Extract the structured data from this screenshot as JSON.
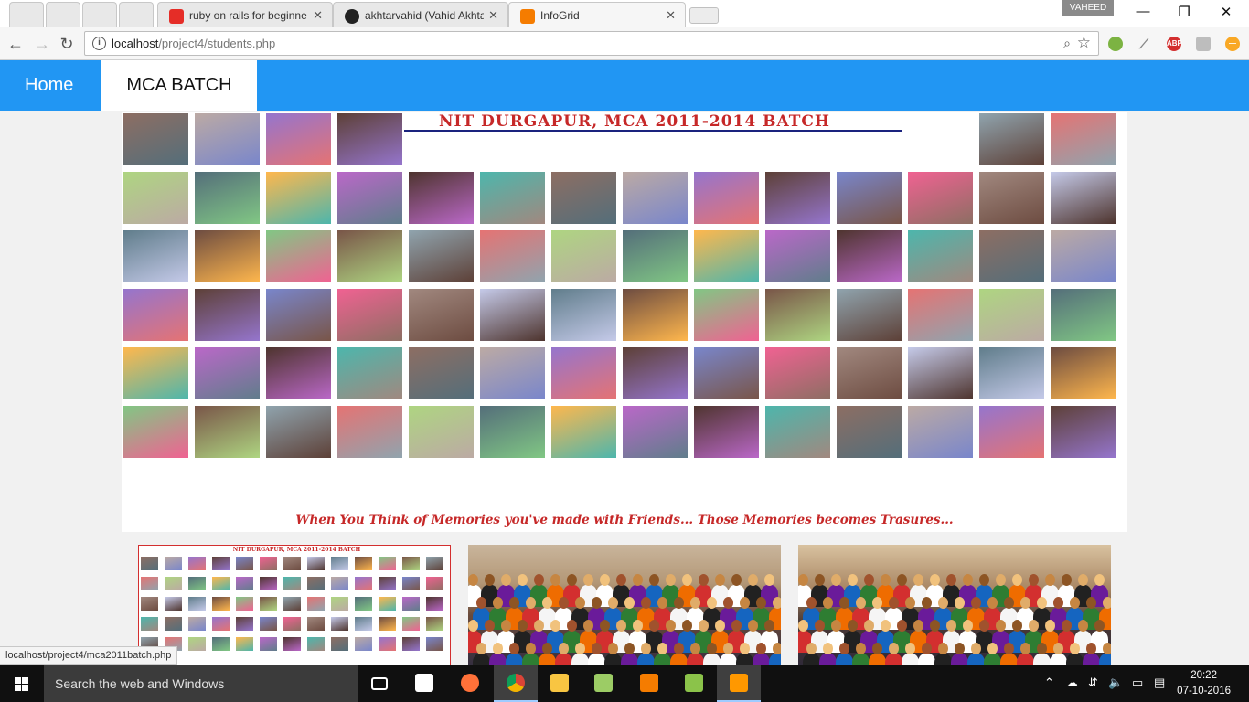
{
  "browser": {
    "tabs": [
      {
        "title": "ruby on rails for beginne",
        "favicon": "youtube-icon",
        "color": "#e52d27"
      },
      {
        "title": "akhtarvahid (Vahid Akhta",
        "favicon": "github-icon",
        "color": "#222222"
      },
      {
        "title": "InfoGrid",
        "favicon": "xampp-icon",
        "color": "#f57c00",
        "active": true
      }
    ],
    "profile_name": "VAHEED",
    "address": {
      "host": "localhost",
      "path": "/project4/students.php"
    }
  },
  "page": {
    "nav": {
      "home_label": "Home",
      "batch_label": "MCA BATCH"
    },
    "collage": {
      "banner": "NIT DURGAPUR, MCA 2011-2014 BATCH",
      "caption": "When You Think of Memories you've made with Friends... Those Memories becomes Trasures..."
    },
    "thumbnails": [
      {
        "name": "collage-thumbnail",
        "banner": "NIT DURGAPUR, MCA 2011-2014 BATCH"
      },
      {
        "name": "group-photo-1"
      },
      {
        "name": "group-photo-2"
      }
    ]
  },
  "status_url": "localhost/project4/mca2011batch.php",
  "taskbar": {
    "search_placeholder": "Search the web and Windows",
    "time": "20:22",
    "date": "07-10-2016"
  },
  "colors": {
    "nav_blue": "#2196f3",
    "banner_red": "#c62828"
  }
}
